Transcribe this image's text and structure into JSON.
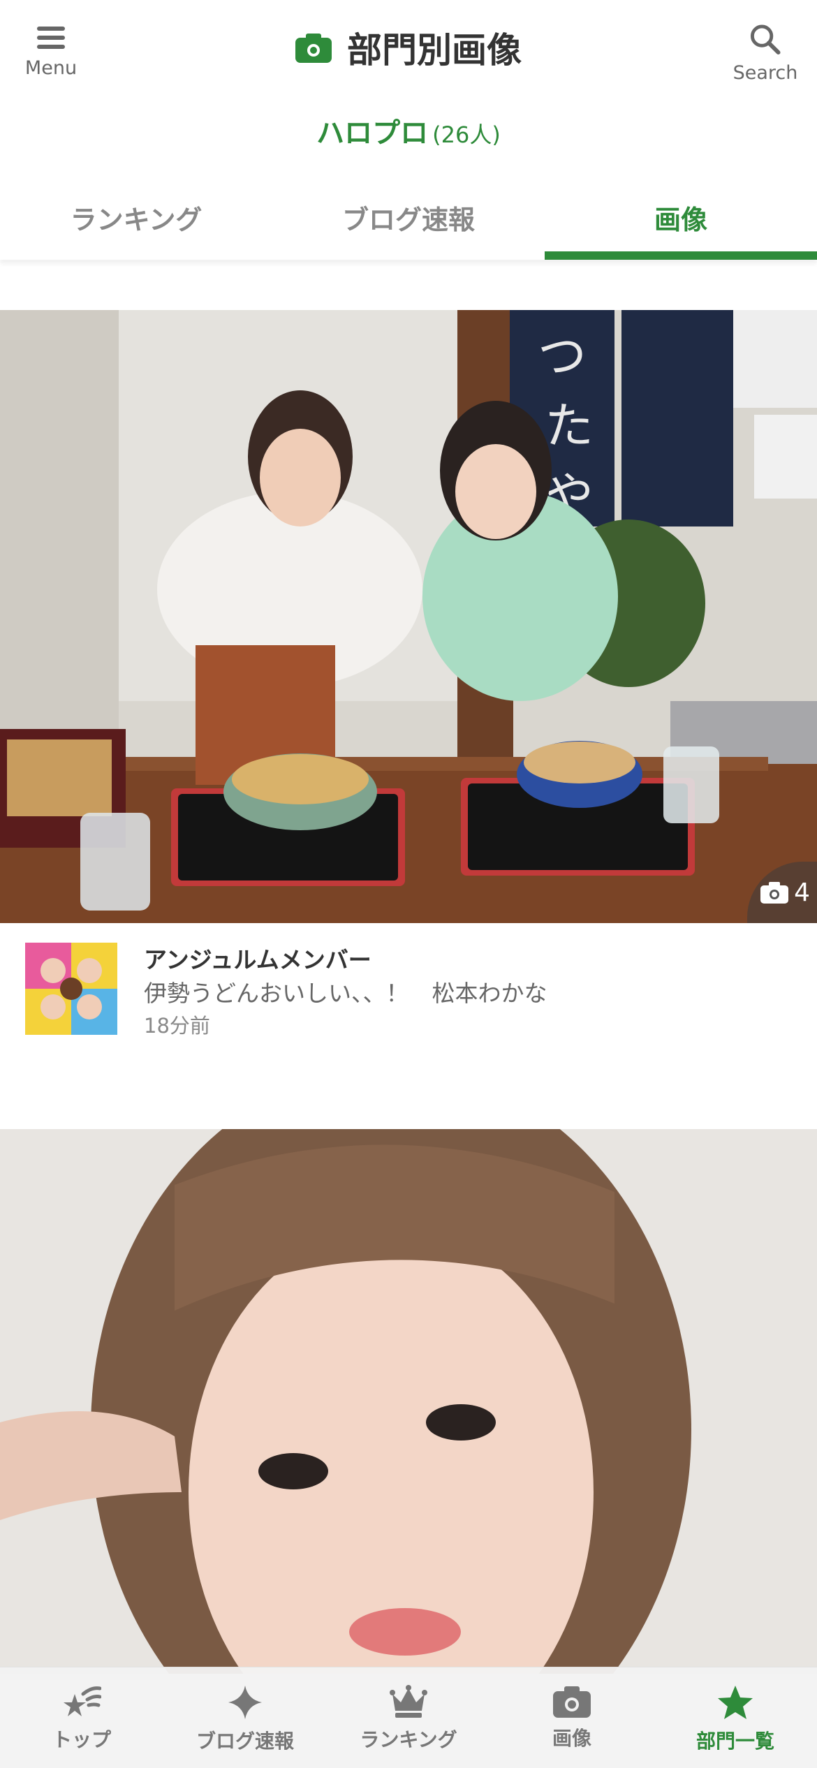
{
  "header": {
    "menu_label": "Menu",
    "title": "部門別画像",
    "search_label": "Search"
  },
  "group": {
    "name": "ハロプロ",
    "count": "(26人)"
  },
  "tabs": [
    {
      "label": "ランキング",
      "active": false
    },
    {
      "label": "ブログ速報",
      "active": false
    },
    {
      "label": "画像",
      "active": true
    }
  ],
  "posts": [
    {
      "photo_count": "4",
      "author": "アンジュルムメンバー",
      "title": "伊勢うどんおいしい、、！　松本わかな",
      "time": "18分前"
    }
  ],
  "bottom_nav": [
    {
      "label": "トップ",
      "icon": "shooting-star-icon"
    },
    {
      "label": "ブログ速報",
      "icon": "sparkle-icon"
    },
    {
      "label": "ランキング",
      "icon": "crown-icon"
    },
    {
      "label": "画像",
      "icon": "camera-icon"
    },
    {
      "label": "部門一覧",
      "icon": "star-icon",
      "active": true
    }
  ],
  "colors": {
    "accent": "#2e8b3a",
    "muted": "#777777"
  }
}
